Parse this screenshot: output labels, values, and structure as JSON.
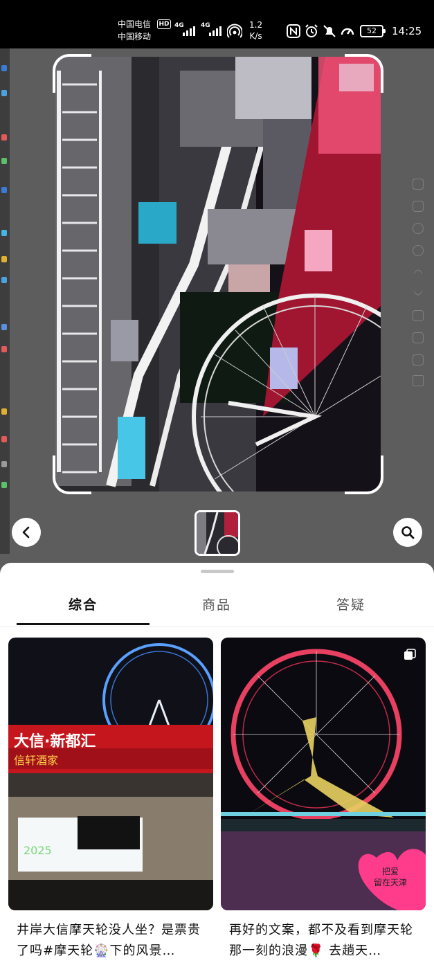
{
  "status_bar": {
    "carrier_1": "中国电信",
    "carrier_2": "中国移动",
    "hd_badge": "HD",
    "network_1": "4G",
    "network_2": "4G",
    "speed_value": "1.2",
    "speed_unit": "K/s",
    "battery": "52",
    "time": "14:25"
  },
  "viewer": {
    "back_icon": "chevron-left-icon",
    "search_icon": "search-icon"
  },
  "tabs": [
    {
      "label": "综合",
      "active": true
    },
    {
      "label": "商品",
      "active": false
    },
    {
      "label": "答疑",
      "active": false
    }
  ],
  "results": [
    {
      "caption": "井岸大信摩天轮没人坐？是票贵了吗#摩天轮🎡下的风景…",
      "sign_text": "大信·新都汇",
      "sign_sub": "信轩酒家",
      "screen_text": "2025"
    },
    {
      "caption": "再好的文案，都不及看到摩天轮那一刻的浪漫🌹  去趟天…",
      "heart_text": "把爱\n留在天津",
      "multi_image_icon": "multi-image-icon"
    }
  ]
}
